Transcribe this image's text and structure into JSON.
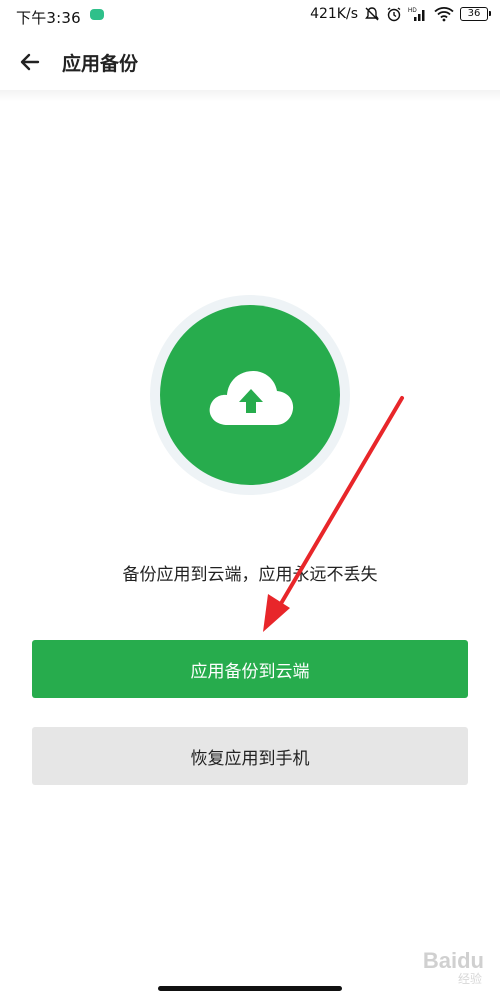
{
  "status_bar": {
    "time": "下午3:36",
    "net_speed": "421K/s",
    "battery": "36",
    "icons": [
      "app-notification-icon",
      "mute-bell-icon",
      "alarm-icon",
      "signal-hd-icon",
      "wifi-icon",
      "battery-icon"
    ]
  },
  "header": {
    "title": "应用备份",
    "back_icon": "arrow-left-icon"
  },
  "main": {
    "illustration_icon": "cloud-upload-icon",
    "tagline": "备份应用到云端，应用永远不丢失",
    "primary_button": "应用备份到云端",
    "secondary_button": "恢复应用到手机"
  },
  "watermark": {
    "text": "Baidu",
    "sub": "经验"
  },
  "colors": {
    "accent": "#27ac4d",
    "secondary_bg": "#e6e6e6",
    "annotation_arrow": "#e8262a"
  }
}
